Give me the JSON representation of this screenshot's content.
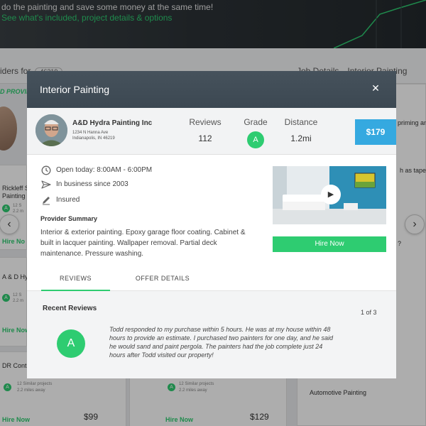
{
  "hero": {
    "line1": "do the painting and save some money at the same time!",
    "line2": "See what's included, project details & options"
  },
  "bg_header": {
    "left_text": "iders for",
    "pill_text": "46219",
    "right_tabs": [
      "Job Details",
      "Interior Painting"
    ]
  },
  "bg_page": {
    "provid_label": "D PROVID",
    "cards": [
      {
        "name": "Rickleff S",
        "name2": "Painting",
        "grade": "A",
        "similar": "12 S",
        "distance": "2.2 m",
        "hire": "Hire No"
      },
      {
        "name": "A & D Hy",
        "grade": "A",
        "similar": "12 S",
        "distance": "2.2 m",
        "hire": "Hire Now"
      },
      {
        "name": "DR Contr",
        "grade": "A",
        "similar": "12 Similar projects",
        "distance": "2.2 miles away",
        "hire": "Hire Now",
        "price": "$99"
      },
      {
        "grade": "A",
        "similar": "12 Similar projects",
        "distance": "2.2 miles away",
        "hire": "Hire Now",
        "price": "$129"
      }
    ],
    "right_snippets": [
      "priming an",
      "h as tape",
      "?",
      "Automotive Painting"
    ]
  },
  "modal": {
    "title": "Interior Painting",
    "provider": {
      "name": "A&D Hydra Painting Inc",
      "address_line1": "1234 N Hanna Ave",
      "address_line2": "Indianapolis, IN 46219"
    },
    "stats": {
      "reviews_label": "Reviews",
      "reviews_value": "112",
      "grade_label": "Grade",
      "grade_value": "A",
      "distance_label": "Distance",
      "distance_value": "1.2mi"
    },
    "price": "$179",
    "info": {
      "hours": "Open today: 8:00AM - 6:00PM",
      "since": "In business since 2003",
      "insured": "Insured"
    },
    "summary_heading": "Provider Summary",
    "summary_text": "Interior & exterior painting. Epoxy garage floor coating. Cabinet & built in lacquer painting. Wallpaper removal. Partial deck maintenance. Pressure washing.",
    "hire_label": "Hire Now",
    "tabs": [
      {
        "label": "REVIEWS",
        "active": true
      },
      {
        "label": "OFFER DETAILS",
        "active": false
      }
    ],
    "reviews": {
      "heading": "Recent Reviews",
      "pager": "1 of 3",
      "reviewer_initial": "A",
      "text": "Todd responded to my purchase within 5 hours.  He was at my house within 48 hours to provide an estimate.  I purchased two painters for one day, and he said he would sand and paint pergola.  The painters had the job complete just 24 hours after Todd visited our property!"
    }
  },
  "icons": [
    "clock-icon",
    "send-icon",
    "pencil-icon",
    "play-icon",
    "close-icon",
    "chevron-left-icon",
    "chevron-right-icon"
  ],
  "colors": {
    "accent_green": "#2ecc71",
    "price_blue": "#35a9e0",
    "modal_header": "#434f59"
  }
}
